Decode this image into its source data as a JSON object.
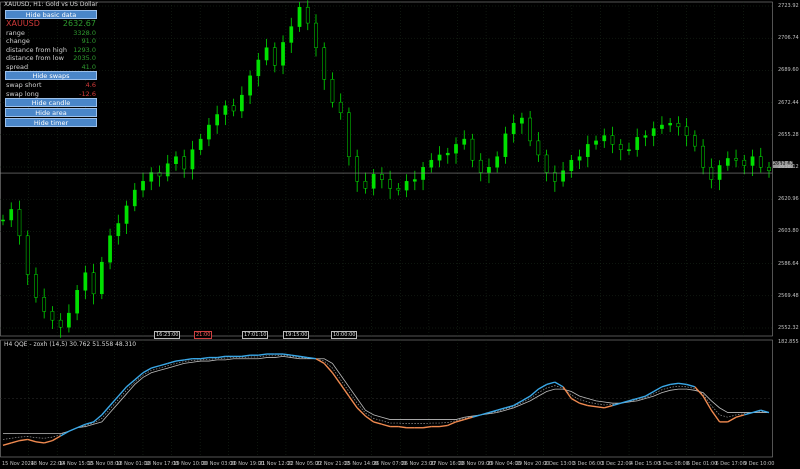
{
  "window": {
    "title": "XAUUSD, H1: Gold vs US Dollar",
    "current_price_label": "2632.67",
    "last_price": 2632.67
  },
  "info_panel": {
    "hide_basic_button": "Hide basic data",
    "symbol": "XAUUSD",
    "price": "2632.67",
    "rows": [
      {
        "label": "range",
        "value": "3328.0",
        "color": "green"
      },
      {
        "label": "change",
        "value": "91.0",
        "color": "green"
      },
      {
        "label": "distance from high",
        "value": "1293.0",
        "color": "green"
      },
      {
        "label": "distance from low",
        "value": "2035.0",
        "color": "green"
      },
      {
        "label": "spread",
        "value": "41.0",
        "color": "green"
      }
    ],
    "hide_swaps_button": "Hide swaps",
    "swaps": [
      {
        "label": "swap short",
        "value": "4.6",
        "color": "red"
      },
      {
        "label": "swap long",
        "value": "-12.6",
        "color": "red"
      }
    ],
    "hide_candle_button": "Hide candle",
    "hide_area_button": "Hide area",
    "hide_timer_button": "Hide timer"
  },
  "indicator": {
    "title": "H4 QQE - zoxh (14,5) 30.762 51.558 48.310",
    "axis_top": "182.855"
  },
  "session_tags": [
    {
      "text": "16:23:00"
    },
    {
      "text": "21:00",
      "color": "red"
    },
    {
      "text": "17:01:10"
    },
    {
      "text": "19:15:00"
    },
    {
      "text": "10:00:00"
    }
  ],
  "price_axis": {
    "labels": [
      "2723.92",
      "2706.74",
      "2689.60",
      "2672.44",
      "2655.28",
      "2638.12",
      "2620.96",
      "2603.80",
      "2586.64",
      "2569.48",
      "2552.32"
    ],
    "colors": {
      "bull": "#00e000",
      "bear": "#00b000",
      "grid": "#1e2e1e",
      "axis": "#8a8a8a"
    }
  },
  "time_axis": {
    "labels": [
      "15 Nov 2024",
      "18 Nov 22:00",
      "14 Nov 15:00",
      "15 Nov 08:00",
      "18 Nov 01:00",
      "18 Nov 17:00",
      "19 Nov 10:00",
      "20 Nov 03:00",
      "20 Nov 19:00",
      "21 Nov 12:00",
      "22 Nov 05:00",
      "22 Nov 21:00",
      "25 Nov 14:00",
      "26 Nov 07:00",
      "26 Nov 23:00",
      "27 Nov 16:00",
      "28 Nov 09:00",
      "29 Nov 04:00",
      "29 Nov 20:00",
      "2 Dec 13:00",
      "3 Dec 06:00",
      "3 Dec 22:00",
      "4 Dec 15:00",
      "5 Dec 08:00",
      "6 Dec 01:00",
      "6 Dec 17:00",
      "9 Dec 10:00"
    ]
  },
  "chart_data": {
    "type": "line",
    "title": "XAUUSD, H1: Gold vs US Dollar",
    "ylim": [
      2540.0,
      2730.0
    ],
    "series": [
      {
        "name": "XAUUSD",
        "values": [
          2606,
          2612,
          2597,
          2575,
          2562,
          2554,
          2549,
          2545,
          2553,
          2566,
          2576,
          2564,
          2582,
          2597,
          2604,
          2614,
          2623,
          2628,
          2633,
          2631,
          2638,
          2642,
          2635,
          2646,
          2652,
          2660,
          2666,
          2671,
          2668,
          2677,
          2688,
          2697,
          2704,
          2694,
          2707,
          2716,
          2727,
          2718,
          2704,
          2686,
          2673,
          2667,
          2642,
          2628,
          2624,
          2632,
          2629,
          2624,
          2623,
          2628,
          2629,
          2636,
          2640,
          2643,
          2644,
          2649,
          2652,
          2640,
          2633,
          2636,
          2642,
          2655,
          2661,
          2664,
          2651,
          2643,
          2633,
          2628,
          2634,
          2640,
          2642,
          2649,
          2651,
          2654,
          2649,
          2646,
          2646,
          2653,
          2654,
          2658,
          2660,
          2661,
          2659,
          2654,
          2648,
          2636,
          2629,
          2637,
          2641,
          2640,
          2637,
          2642,
          2636,
          2634
        ]
      }
    ]
  },
  "indicator_data": {
    "type": "line",
    "ylim": [
      0,
      100
    ],
    "series": [
      {
        "name": "QQE fast",
        "values": [
          10,
          12,
          14,
          15,
          13,
          12,
          14,
          18,
          22,
          25,
          28,
          30,
          36,
          44,
          52,
          60,
          66,
          72,
          76,
          78,
          80,
          82,
          83,
          84,
          84,
          85,
          85,
          86,
          86,
          86,
          87,
          87,
          88,
          88,
          88,
          87,
          86,
          85,
          84,
          80,
          72,
          62,
          52,
          42,
          35,
          30,
          28,
          26,
          26,
          25,
          25,
          25,
          26,
          26,
          27,
          30,
          32,
          34,
          36,
          38,
          40,
          42,
          44,
          48,
          52,
          58,
          62,
          64,
          60,
          50,
          46,
          44,
          43,
          42,
          44,
          46,
          48,
          50,
          52,
          56,
          60,
          62,
          63,
          62,
          60,
          52,
          40,
          30,
          30,
          34,
          36,
          38,
          40,
          38
        ]
      },
      {
        "name": "QQE slow",
        "values": [
          20,
          20,
          20,
          20,
          20,
          20,
          20,
          20,
          22,
          25,
          26,
          28,
          30,
          38,
          46,
          54,
          62,
          68,
          72,
          74,
          76,
          78,
          80,
          81,
          82,
          82,
          83,
          83,
          84,
          84,
          84,
          84,
          85,
          85,
          86,
          85,
          84,
          84,
          84,
          84,
          80,
          70,
          60,
          50,
          40,
          36,
          34,
          32,
          32,
          32,
          32,
          32,
          32,
          32,
          32,
          32,
          34,
          35,
          36,
          37,
          38,
          40,
          42,
          45,
          48,
          52,
          56,
          58,
          58,
          56,
          52,
          50,
          48,
          47,
          46,
          46,
          47,
          48,
          50,
          52,
          55,
          57,
          58,
          58,
          57,
          55,
          48,
          42,
          38,
          38,
          38,
          38,
          38,
          38
        ]
      }
    ]
  }
}
